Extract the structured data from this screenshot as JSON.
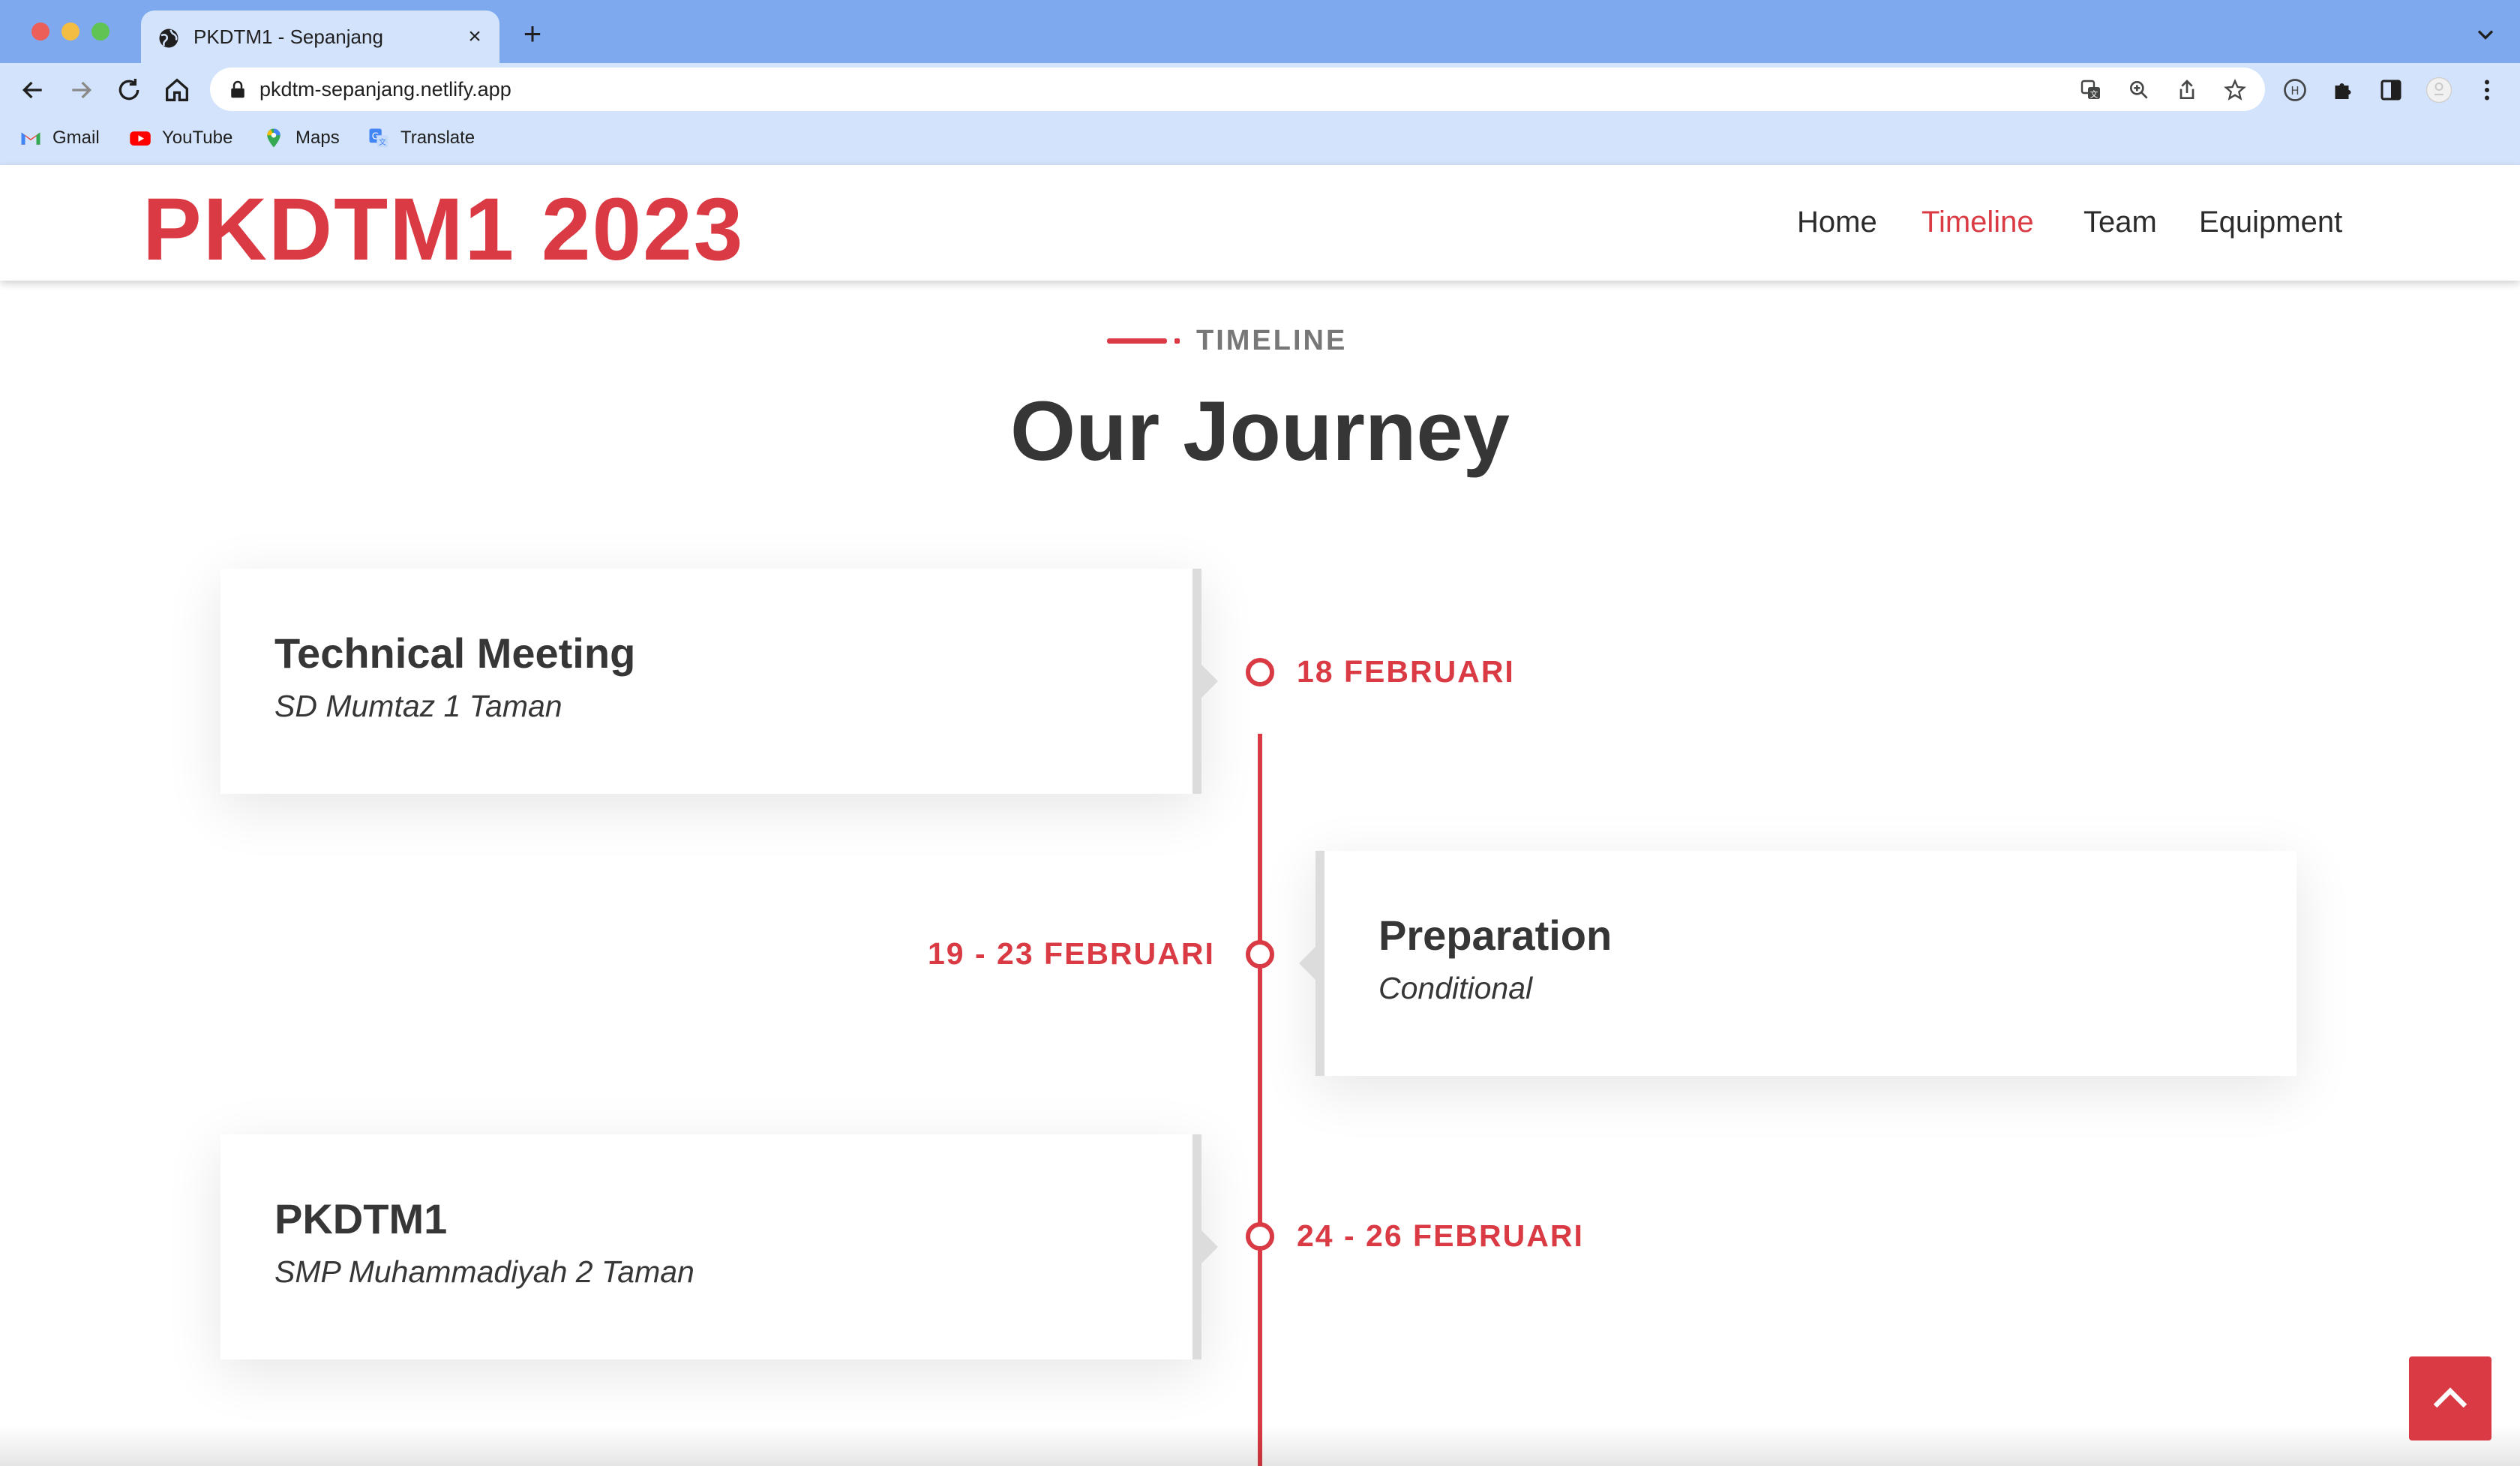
{
  "browser": {
    "tab_title": "PKDTM1 - Sepanjang",
    "url": "pkdtm-sepanjang.netlify.app",
    "bookmarks": [
      {
        "label": "Gmail",
        "icon": "gmail-icon"
      },
      {
        "label": "YouTube",
        "icon": "youtube-icon"
      },
      {
        "label": "Maps",
        "icon": "maps-icon"
      },
      {
        "label": "Translate",
        "icon": "translate-icon"
      }
    ]
  },
  "site": {
    "logo": "PKDTM1 2023",
    "nav": [
      {
        "label": "Home",
        "active": false
      },
      {
        "label": "Timeline",
        "active": true
      },
      {
        "label": "Team",
        "active": false
      },
      {
        "label": "Equipment",
        "active": false
      }
    ]
  },
  "timeline": {
    "section_label": "TIMELINE",
    "title": "Our Journey",
    "events": [
      {
        "date": "18 FEBRUARI",
        "title": "Technical Meeting",
        "subtitle": "SD Mumtaz 1 Taman",
        "side": "left"
      },
      {
        "date": "19 - 23 FEBRUARI",
        "title": "Preparation",
        "subtitle": "Conditional",
        "side": "right"
      },
      {
        "date": "24 - 26 FEBRUARI",
        "title": "PKDTM1",
        "subtitle": "SMP Muhammadiyah 2 Taman",
        "side": "left"
      }
    ]
  },
  "colors": {
    "accent": "#d93a43",
    "titlebar": "#7fa9ef",
    "toolbar": "#d3e3fb",
    "text_dark": "#363636"
  }
}
